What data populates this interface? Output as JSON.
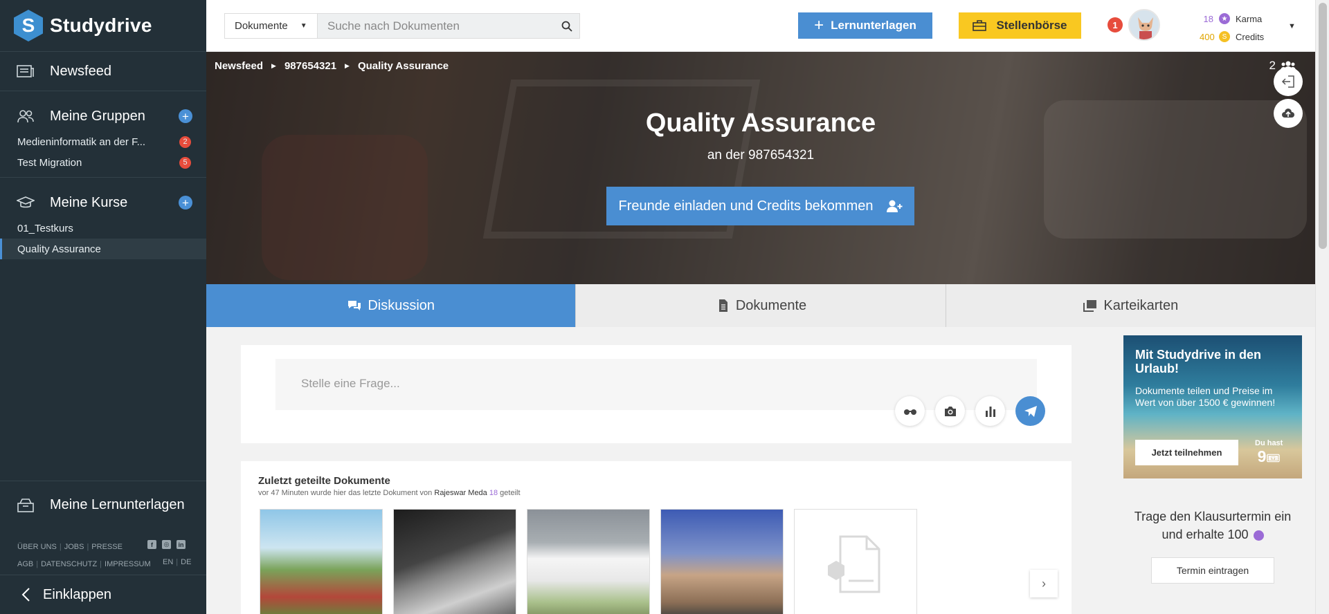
{
  "app": {
    "name": "Studydrive",
    "logo_letter": "S"
  },
  "sidebar": {
    "newsfeed": "Newsfeed",
    "groups": {
      "title": "Meine Gruppen",
      "items": [
        {
          "label": "Medieninformatik an der F...",
          "badge": "2"
        },
        {
          "label": "Test Migration",
          "badge": "5"
        }
      ]
    },
    "courses": {
      "title": "Meine Kurse",
      "items": [
        {
          "label": "01_Testkurs"
        },
        {
          "label": "Quality Assurance"
        }
      ]
    },
    "plus": "+",
    "my_materials": "Meine Lernunterlagen",
    "footer": {
      "about": "ÜBER UNS",
      "jobs": "JOBS",
      "press": "PRESSE",
      "agb": "AGB",
      "privacy": "DATENSCHUTZ",
      "imprint": "IMPRESSUM",
      "lang_en": "EN",
      "lang_de": "DE",
      "sep": "|"
    },
    "social": {
      "facebook": "f",
      "instagram": "◎",
      "linkedin": "in"
    },
    "collapse": "Einklappen"
  },
  "topbar": {
    "search_select": "Dokumente",
    "search_placeholder": "Suche nach Dokumenten",
    "btn_materials": "Lernunterlagen",
    "btn_jobs": "Stellenbörse",
    "notifications": "1",
    "karma": {
      "value": "18",
      "label": "Karma"
    },
    "credits": {
      "value": "400",
      "label": "Credits"
    }
  },
  "hero": {
    "breadcrumb": [
      "Newsfeed",
      "987654321",
      "Quality Assurance"
    ],
    "members": "2",
    "title": "Quality Assurance",
    "subtitle": "an der 987654321",
    "invite": "Freunde einladen und Credits bekommen"
  },
  "tabs": [
    "Diskussion",
    "Dokumente",
    "Karteikarten"
  ],
  "ask": {
    "placeholder": "Stelle eine Frage..."
  },
  "docs": {
    "title": "Zuletzt geteilte Dokumente",
    "sub_prefix": "vor 47 Minuten wurde hier das letzte Dokument von",
    "user": "Rajeswar Meda",
    "user_karma": "18",
    "sub_suffix": "geteilt"
  },
  "promo": {
    "title": "Mit Studydrive in den Urlaub!",
    "text": "Dokumente teilen und Preise im Wert von über 1500 € gewinnen!",
    "button": "Jetzt teilnehmen",
    "has_label": "Du hast",
    "has_value": "9"
  },
  "exam": {
    "text": "Trage den Klausurtermin ein und erhalte 100",
    "button": "Termin eintragen"
  },
  "colors": {
    "accent": "#4a8ed2",
    "sidebar": "#233038",
    "yellow": "#f9c821",
    "badge_red": "#e74c3c",
    "karma_purple": "#9b6bd6"
  }
}
